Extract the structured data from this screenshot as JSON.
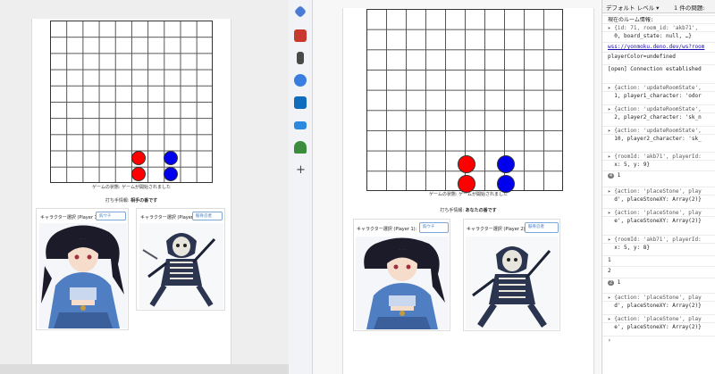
{
  "colors": {
    "red": "#ff0000",
    "blue": "#0000ee",
    "link": "#1a0dab",
    "select_border": "#7aa6d8"
  },
  "left": {
    "status": "ゲームの状態: ゲームが開始されました",
    "turn_label": "打ち手情報:",
    "turn_value": "相手の番です",
    "player1_label": "キャラクター選択 (Player 1):",
    "player1_select": "鈎ウチ",
    "player2_label": "キャラクター選択 (Player 2):",
    "player2_select": "骸骨忍者"
  },
  "right": {
    "status": "ゲームの状態: ゲームが開始されました",
    "turn_label": "打ち手情報:",
    "turn_value": "あなたの番です",
    "player1_label": "キャラクター選択 (Player 1):",
    "player1_select": "鈎ウチ",
    "player2_label": "キャラクター選択 (Player 2):",
    "player2_select": "骸骨忍者"
  },
  "sidebar": {
    "icons": [
      "tag-icon",
      "toolbox-icon",
      "chess-icon",
      "gear-app-icon",
      "outlook-icon",
      "cart-icon",
      "tree-icon",
      "plus-icon"
    ]
  },
  "devtools": {
    "level_label": "デフォルト レベル ▾",
    "issues_label": "1 件の問題:",
    "lines": [
      {
        "text": "現在のルーム情報:"
      },
      {
        "text": "▸ {id: 71, room_id: 'akb71',"
      },
      {
        "text": "  0, board_state: null, …}"
      },
      {
        "text": "wss://yonmoku.deno.dev/ws?room"
      },
      {
        "text": "playerColor=undefined"
      },
      {
        "text": "[open] Connection established"
      },
      {
        "text": "▸ {action: 'updateRoomState',"
      },
      {
        "text": "  1, player1_character: 'odor"
      },
      {
        "text": "▸ {action: 'updateRoomState',"
      },
      {
        "text": "  2, player2_character: 'sk_n"
      },
      {
        "text": "▸ {action: 'updateRoomState',"
      },
      {
        "text": "  10, player2_character: 'sk_"
      },
      {
        "text": "▸ {roomId: 'akb71', playerId:"
      },
      {
        "text": "  x: 5, y: 9}"
      },
      {
        "text": "1",
        "count": "4"
      },
      {
        "text": "▸ {action: 'placeStone', play"
      },
      {
        "text": "  d', placeStoneXY: Array(2)}"
      },
      {
        "text": "▸ {action: 'placeStone', play"
      },
      {
        "text": "  e', placeStoneXY: Array(2)}"
      },
      {
        "text": "▸ {roomId: 'akb71', playerId:"
      },
      {
        "text": "  x: 5, y: 8}"
      },
      {
        "text": "1"
      },
      {
        "text": "2"
      },
      {
        "text": "1",
        "count": "2"
      },
      {
        "text": "▸ {action: 'placeStone', play"
      },
      {
        "text": "  d', placeStoneXY: Array(2)}"
      },
      {
        "text": "▸ {action: 'placeStone', play"
      },
      {
        "text": "  e', placeStoneXY: Array(2)}"
      },
      {
        "text": "›"
      }
    ]
  }
}
